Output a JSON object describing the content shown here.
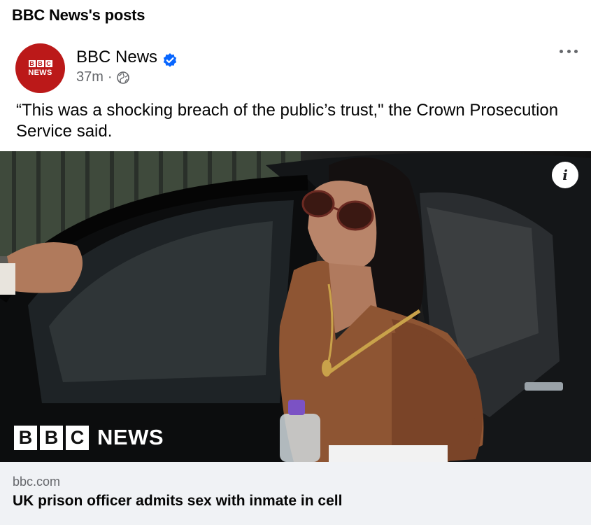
{
  "section": {
    "title": "BBC News's posts"
  },
  "post": {
    "page_name": "BBC News",
    "avatar": {
      "blocks": [
        "B",
        "B",
        "C"
      ],
      "word": "NEWS",
      "color": "#bb1919"
    },
    "verified_icon": "verified-badge-icon",
    "time": "37m",
    "separator": "·",
    "audience_icon": "globe-icon",
    "text": "“This was a shocking breach of the public’s trust,\" the Crown Prosecution Service said.",
    "more_icon": "more-options-icon"
  },
  "media": {
    "info_icon_label": "i",
    "watermark": {
      "blocks": [
        "B",
        "B",
        "C"
      ],
      "word": "NEWS"
    }
  },
  "link_card": {
    "domain": "bbc.com",
    "title": "UK prison officer admits sex with inmate in cell"
  },
  "colors": {
    "verified": "#0866ff",
    "secondary_text": "#65676b",
    "card_bg": "#f0f2f5"
  }
}
